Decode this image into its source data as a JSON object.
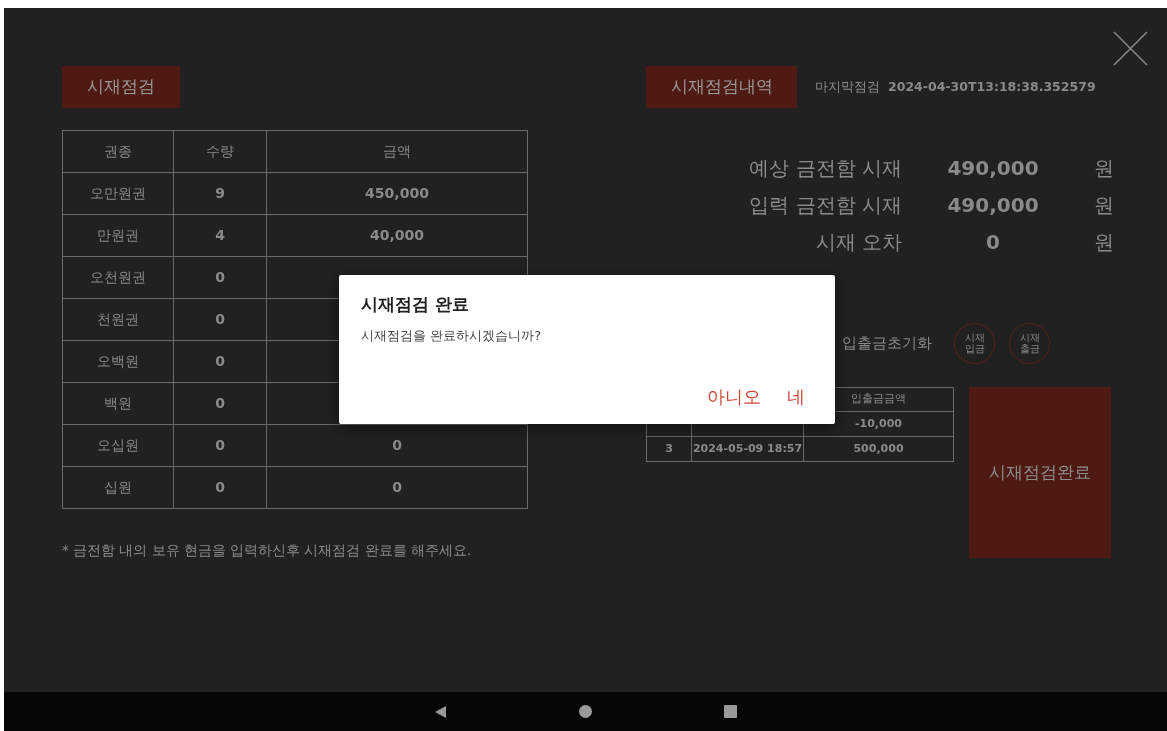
{
  "inventory": {
    "title": "시재점검",
    "columns": [
      "권종",
      "수량",
      "금액"
    ],
    "rows": [
      {
        "denomination": "오만원권",
        "count": "9",
        "amount": "450,000"
      },
      {
        "denomination": "만원권",
        "count": "4",
        "amount": "40,000"
      },
      {
        "denomination": "오천원권",
        "count": "0"
      },
      {
        "denomination": "천원권",
        "count": "0"
      },
      {
        "denomination": "오백원",
        "count": "0"
      },
      {
        "denomination": "백원",
        "count": "0"
      },
      {
        "denomination": "오십원",
        "count": "0",
        "amount": "0"
      },
      {
        "denomination": "십원",
        "count": "0",
        "amount": "0"
      }
    ],
    "note": "* 금전함 내의 보유 현금을 입력하신후 시재점검 완료를 해주세요."
  },
  "history": {
    "title": "시재점검내역",
    "last_check_label": "마지막점검",
    "last_check_value": "2024-04-30T13:18:38.352579",
    "summary": [
      {
        "label": "예상 금전함 시재",
        "value": "490,000",
        "unit": "원"
      },
      {
        "label": "입력 금전함 시재",
        "value": "490,000",
        "unit": "원"
      },
      {
        "label": "시재 오차",
        "value": "0",
        "unit": "원"
      }
    ],
    "reset_label": "입출금초기화",
    "round_buttons": [
      "시재\n입금",
      "시재\n출금"
    ],
    "table": {
      "column_3": "입출금금액",
      "rows": [
        {
          "column_3": "-10,000"
        },
        {
          "column_1": "3",
          "column_2": "2024-05-09 18:57",
          "column_3": "500,000"
        }
      ]
    },
    "complete_button": "시재점검완료"
  },
  "dialog": {
    "title": "시재점검 완료",
    "message": "시재점검을 완료하시겠습니까?",
    "buttons": [
      "아니오",
      "네"
    ]
  }
}
